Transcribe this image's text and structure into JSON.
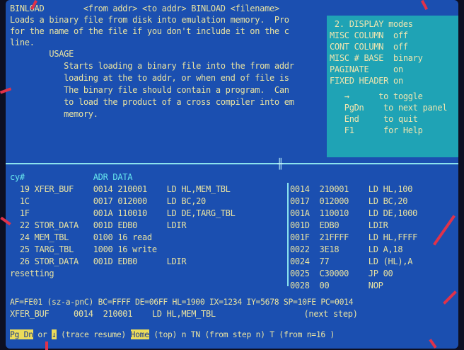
{
  "help": {
    "lines": [
      "BINLOAD        <from addr> <to addr> BINLOAD <filename>",
      "Loads a binary file from disk into emulation memory.  Pro",
      "for the name of the file if you don't include it on the c",
      "line.",
      "        USAGE",
      "           Starts loading a binary file into the from addr",
      "           loading at the to addr, or when end of file is",
      "           The binary file should contain a program.  Can",
      "           to load the product of a cross compiler into em",
      "           memory."
    ]
  },
  "panel": {
    "lines": [
      " 2. DISPLAY modes",
      "MISC COLUMN  off",
      "CONT COLUMN  off",
      "MISC # BASE  binary",
      "PAGINATE     on",
      "FIXED HEADER on",
      "   →      to toggle",
      "   PgDn    to next panel",
      "   End     to quit",
      "   F1      for Help"
    ]
  },
  "trace": {
    "header": "cy#              ADR DATA",
    "rows": [
      "  19 XFER_BUF    0014 210001    LD HL,MEM_TBL",
      "  1C             0017 012000    LD BC,20",
      "  1F             001A 110010    LD DE,TARG_TBL",
      "  22 STOR_DATA   001D EDB0      LDIR",
      "  24 MEM_TBL     0100 16 read",
      "  25 TARG_TBL    1000 16 write",
      "  26 STOR_DATA   001D EDB0      LDIR",
      "resetting"
    ]
  },
  "disasm": {
    "rows": [
      "0014  210001    LD HL,100",
      "0017  012000    LD BC,20",
      "001A  110010    LD DE,1000",
      "001D  EDB0      LDIR",
      "001F  21FFFF    LD HL,FFFF",
      "0022  3E18      LD A,18",
      "0024  77        LD (HL),A",
      "0025  C30000    JP 00",
      "0028  00        NOP"
    ]
  },
  "status": {
    "registers": "AF=FE01 (sz-a-pnC) BC=FFFF DE=06FF HL=1900 IX=1234 IY=5678 SP=10FE PC=0014",
    "current": "XFER_BUF     0014  210001    LD HL,MEM_TBL                  (next step)",
    "key1": "Pg Dn",
    "or": " or ",
    "down": "↓",
    "resume": " (trace resume) ",
    "key2": "Home",
    "rest": " (top) n TN (from step n) T (from n=16 )"
  },
  "colors": {
    "screen": "#1b4fb0",
    "panel": "#1fa3b5",
    "text": "#e9e3a2",
    "label": "#66e6ee",
    "highlight": "#ecdc5a"
  }
}
